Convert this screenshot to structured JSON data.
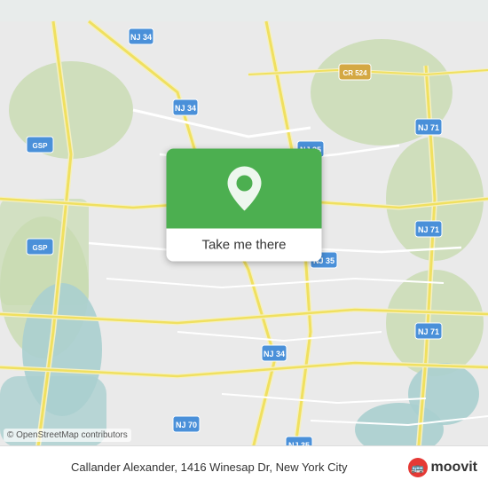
{
  "map": {
    "attribution": "© OpenStreetMap contributors",
    "background_color": "#e8eceb"
  },
  "button": {
    "label": "Take me there",
    "background_color": "#4caf50"
  },
  "bottom_bar": {
    "location_text": "Callander Alexander, 1416 Winesap Dr, New York City",
    "logo_text": "moovit"
  },
  "icons": {
    "pin": "📍",
    "moovit": "🚌"
  }
}
